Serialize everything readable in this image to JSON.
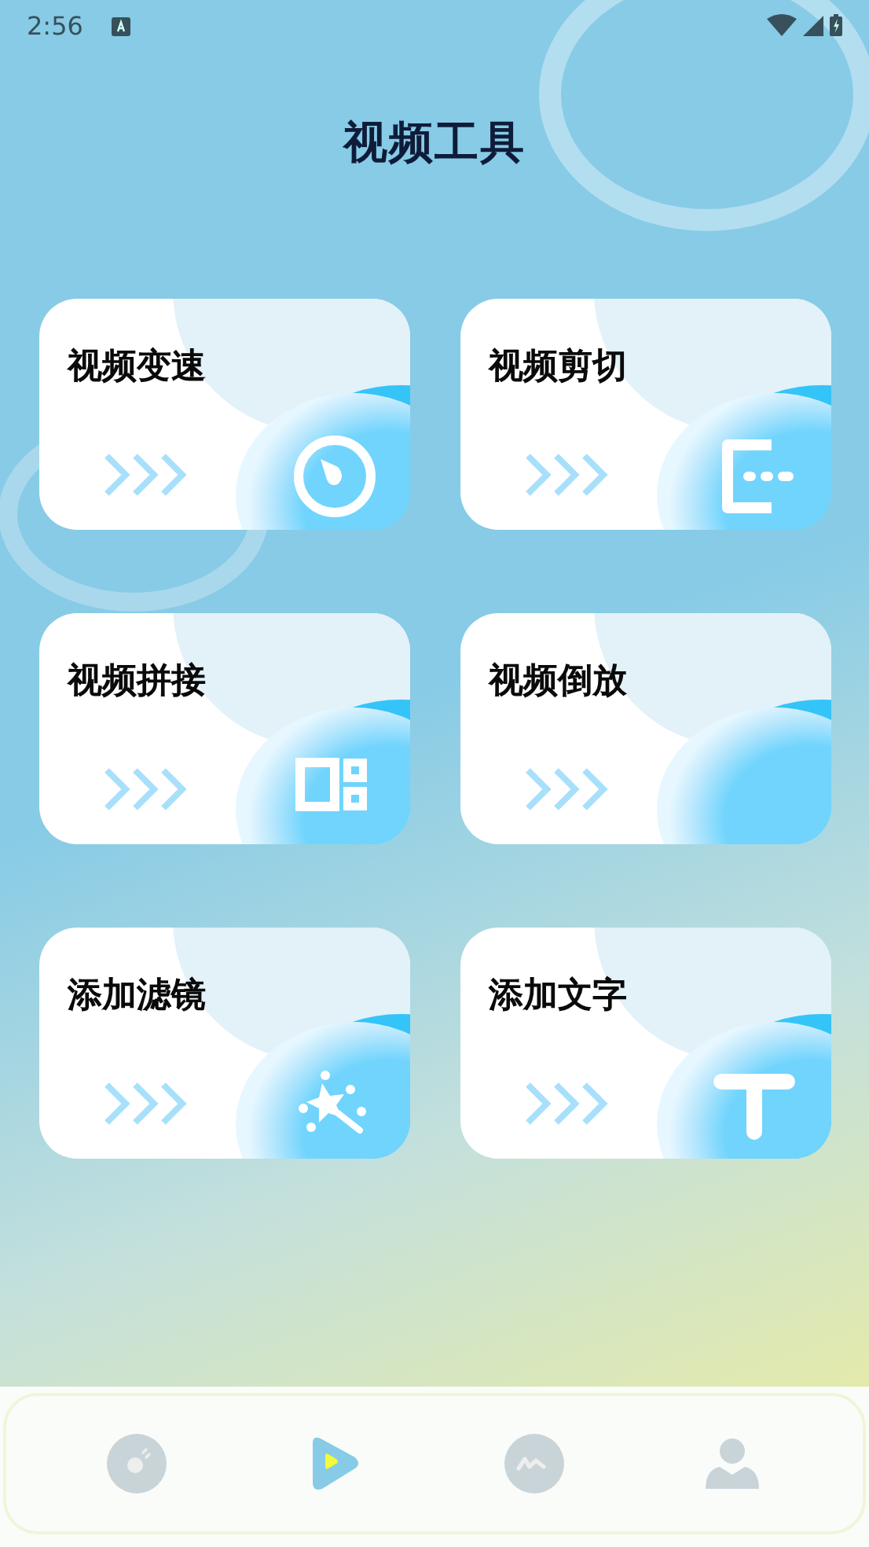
{
  "status_bar": {
    "time": "2:56"
  },
  "title": "视频工具",
  "tools": [
    {
      "label": "视频变速",
      "kind": "speed"
    },
    {
      "label": "视频剪切",
      "kind": "cut"
    },
    {
      "label": "视频拼接",
      "kind": "grid"
    },
    {
      "label": "视频倒放",
      "kind": "none"
    },
    {
      "label": "添加滤镜",
      "kind": "magic"
    },
    {
      "label": "添加文字",
      "kind": "text"
    }
  ],
  "nav": [
    {
      "kind": "music",
      "selected": false
    },
    {
      "kind": "video",
      "selected": true
    },
    {
      "kind": "chart",
      "selected": false
    },
    {
      "kind": "profile",
      "selected": false
    }
  ]
}
